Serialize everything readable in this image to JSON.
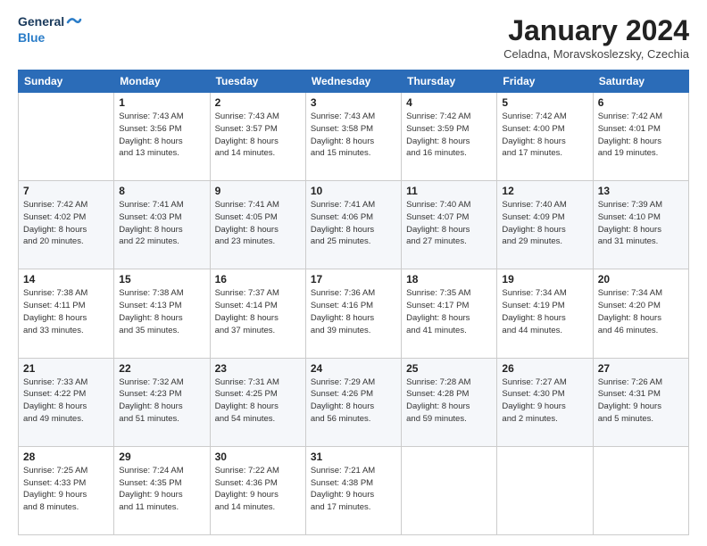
{
  "logo": {
    "line1": "General",
    "line2": "Blue"
  },
  "header": {
    "month": "January 2024",
    "location": "Celadna, Moravskoslezsky, Czechia"
  },
  "weekdays": [
    "Sunday",
    "Monday",
    "Tuesday",
    "Wednesday",
    "Thursday",
    "Friday",
    "Saturday"
  ],
  "weeks": [
    [
      {
        "day": "",
        "info": ""
      },
      {
        "day": "1",
        "info": "Sunrise: 7:43 AM\nSunset: 3:56 PM\nDaylight: 8 hours\nand 13 minutes."
      },
      {
        "day": "2",
        "info": "Sunrise: 7:43 AM\nSunset: 3:57 PM\nDaylight: 8 hours\nand 14 minutes."
      },
      {
        "day": "3",
        "info": "Sunrise: 7:43 AM\nSunset: 3:58 PM\nDaylight: 8 hours\nand 15 minutes."
      },
      {
        "day": "4",
        "info": "Sunrise: 7:42 AM\nSunset: 3:59 PM\nDaylight: 8 hours\nand 16 minutes."
      },
      {
        "day": "5",
        "info": "Sunrise: 7:42 AM\nSunset: 4:00 PM\nDaylight: 8 hours\nand 17 minutes."
      },
      {
        "day": "6",
        "info": "Sunrise: 7:42 AM\nSunset: 4:01 PM\nDaylight: 8 hours\nand 19 minutes."
      }
    ],
    [
      {
        "day": "7",
        "info": "Sunrise: 7:42 AM\nSunset: 4:02 PM\nDaylight: 8 hours\nand 20 minutes."
      },
      {
        "day": "8",
        "info": "Sunrise: 7:41 AM\nSunset: 4:03 PM\nDaylight: 8 hours\nand 22 minutes."
      },
      {
        "day": "9",
        "info": "Sunrise: 7:41 AM\nSunset: 4:05 PM\nDaylight: 8 hours\nand 23 minutes."
      },
      {
        "day": "10",
        "info": "Sunrise: 7:41 AM\nSunset: 4:06 PM\nDaylight: 8 hours\nand 25 minutes."
      },
      {
        "day": "11",
        "info": "Sunrise: 7:40 AM\nSunset: 4:07 PM\nDaylight: 8 hours\nand 27 minutes."
      },
      {
        "day": "12",
        "info": "Sunrise: 7:40 AM\nSunset: 4:09 PM\nDaylight: 8 hours\nand 29 minutes."
      },
      {
        "day": "13",
        "info": "Sunrise: 7:39 AM\nSunset: 4:10 PM\nDaylight: 8 hours\nand 31 minutes."
      }
    ],
    [
      {
        "day": "14",
        "info": "Sunrise: 7:38 AM\nSunset: 4:11 PM\nDaylight: 8 hours\nand 33 minutes."
      },
      {
        "day": "15",
        "info": "Sunrise: 7:38 AM\nSunset: 4:13 PM\nDaylight: 8 hours\nand 35 minutes."
      },
      {
        "day": "16",
        "info": "Sunrise: 7:37 AM\nSunset: 4:14 PM\nDaylight: 8 hours\nand 37 minutes."
      },
      {
        "day": "17",
        "info": "Sunrise: 7:36 AM\nSunset: 4:16 PM\nDaylight: 8 hours\nand 39 minutes."
      },
      {
        "day": "18",
        "info": "Sunrise: 7:35 AM\nSunset: 4:17 PM\nDaylight: 8 hours\nand 41 minutes."
      },
      {
        "day": "19",
        "info": "Sunrise: 7:34 AM\nSunset: 4:19 PM\nDaylight: 8 hours\nand 44 minutes."
      },
      {
        "day": "20",
        "info": "Sunrise: 7:34 AM\nSunset: 4:20 PM\nDaylight: 8 hours\nand 46 minutes."
      }
    ],
    [
      {
        "day": "21",
        "info": "Sunrise: 7:33 AM\nSunset: 4:22 PM\nDaylight: 8 hours\nand 49 minutes."
      },
      {
        "day": "22",
        "info": "Sunrise: 7:32 AM\nSunset: 4:23 PM\nDaylight: 8 hours\nand 51 minutes."
      },
      {
        "day": "23",
        "info": "Sunrise: 7:31 AM\nSunset: 4:25 PM\nDaylight: 8 hours\nand 54 minutes."
      },
      {
        "day": "24",
        "info": "Sunrise: 7:29 AM\nSunset: 4:26 PM\nDaylight: 8 hours\nand 56 minutes."
      },
      {
        "day": "25",
        "info": "Sunrise: 7:28 AM\nSunset: 4:28 PM\nDaylight: 8 hours\nand 59 minutes."
      },
      {
        "day": "26",
        "info": "Sunrise: 7:27 AM\nSunset: 4:30 PM\nDaylight: 9 hours\nand 2 minutes."
      },
      {
        "day": "27",
        "info": "Sunrise: 7:26 AM\nSunset: 4:31 PM\nDaylight: 9 hours\nand 5 minutes."
      }
    ],
    [
      {
        "day": "28",
        "info": "Sunrise: 7:25 AM\nSunset: 4:33 PM\nDaylight: 9 hours\nand 8 minutes."
      },
      {
        "day": "29",
        "info": "Sunrise: 7:24 AM\nSunset: 4:35 PM\nDaylight: 9 hours\nand 11 minutes."
      },
      {
        "day": "30",
        "info": "Sunrise: 7:22 AM\nSunset: 4:36 PM\nDaylight: 9 hours\nand 14 minutes."
      },
      {
        "day": "31",
        "info": "Sunrise: 7:21 AM\nSunset: 4:38 PM\nDaylight: 9 hours\nand 17 minutes."
      },
      {
        "day": "",
        "info": ""
      },
      {
        "day": "",
        "info": ""
      },
      {
        "day": "",
        "info": ""
      }
    ]
  ]
}
